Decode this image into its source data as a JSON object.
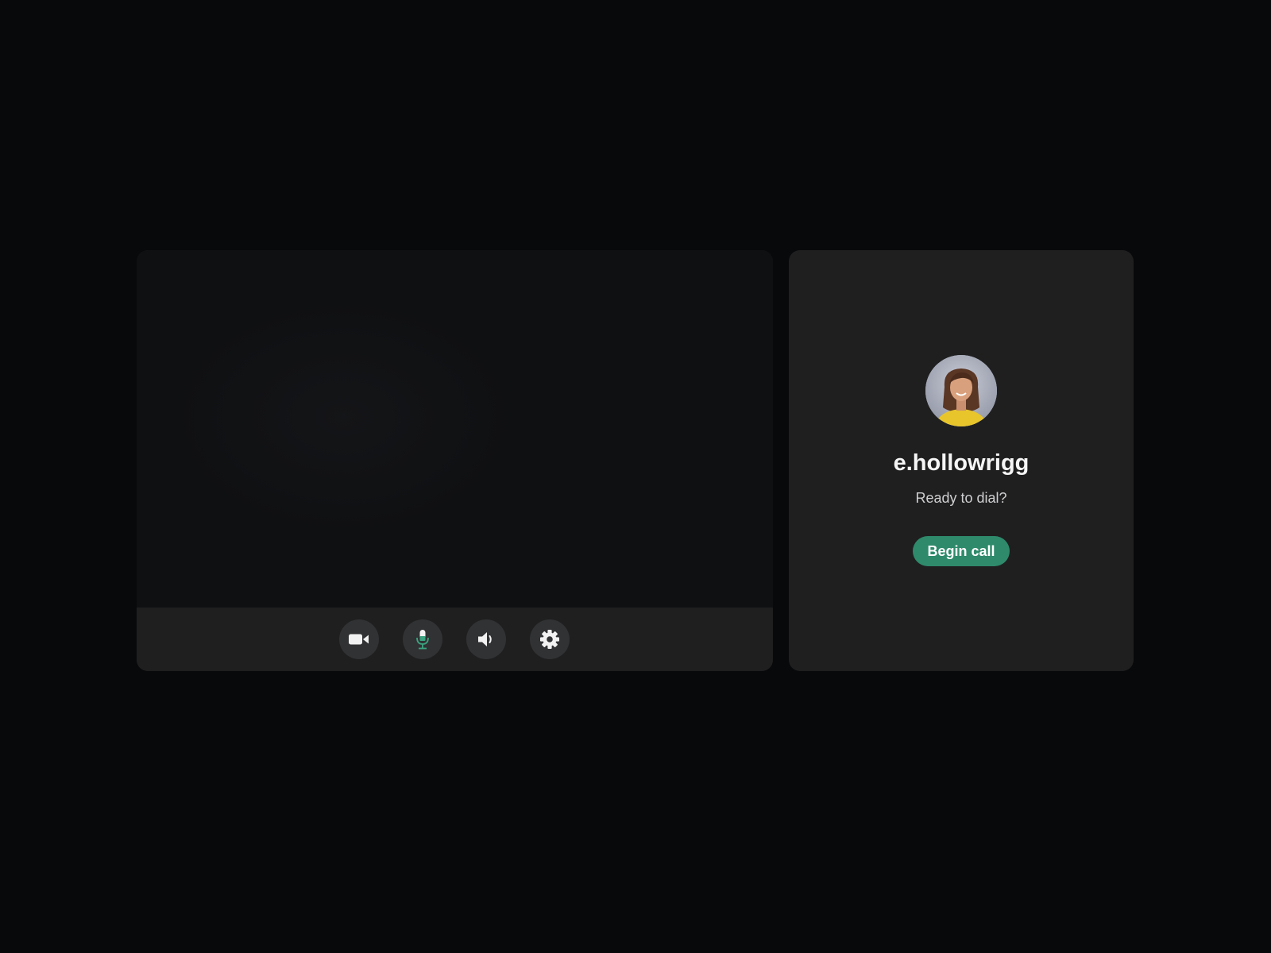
{
  "contact": {
    "username": "e.hollowrigg",
    "status": "Ready to dial?",
    "begin_label": "Begin call"
  },
  "controls": [
    {
      "name": "camera",
      "icon": "video-camera-icon"
    },
    {
      "name": "microphone",
      "icon": "microphone-icon",
      "active": true
    },
    {
      "name": "speaker",
      "icon": "speaker-icon"
    },
    {
      "name": "settings",
      "icon": "gear-icon"
    }
  ],
  "colors": {
    "background": "#08090b",
    "card": "#1f1f20",
    "video_preview": "#0f1012",
    "control_button": "#313234",
    "accent": "#2e8a6b",
    "mic_active": "#3aa37f"
  }
}
